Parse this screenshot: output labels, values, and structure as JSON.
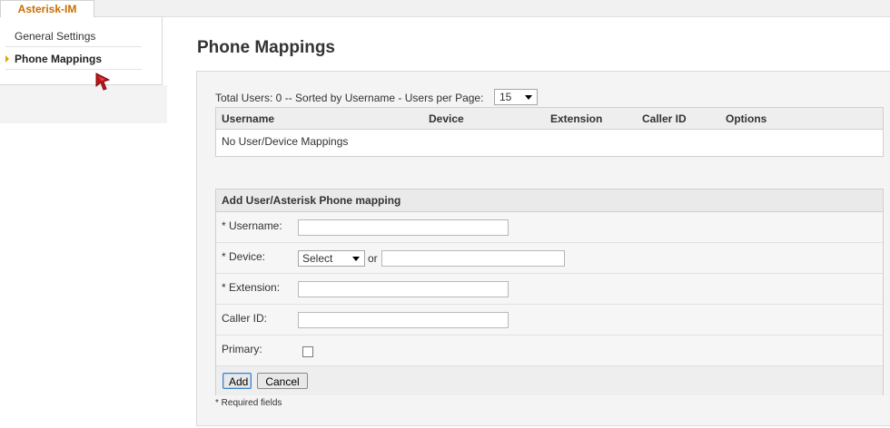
{
  "sidebar": {
    "tab_label": "Asterisk-IM",
    "items": [
      {
        "label": "General Settings"
      },
      {
        "label": "Phone Mappings"
      }
    ]
  },
  "main": {
    "title": "Phone Mappings",
    "summary": "Total Users: 0 -- Sorted by Username - Users per Page:",
    "per_page_value": "15",
    "table": {
      "columns": [
        "Username",
        "Device",
        "Extension",
        "Caller ID",
        "Options"
      ],
      "empty_message": "No User/Device Mappings"
    },
    "form": {
      "title": "Add User/Asterisk Phone mapping",
      "username_label": "* Username:",
      "device_label": "* Device:",
      "device_select_value": "Select",
      "or_text": "or",
      "extension_label": "* Extension:",
      "callerid_label": "Caller ID:",
      "primary_label": "Primary:",
      "add_button": "Add",
      "cancel_button": "Cancel"
    },
    "required_note": "* Required fields"
  },
  "colors": {
    "tab_text": "#c86d00",
    "arrow": "#e8a000",
    "cursor": "#c0141a",
    "focus_button": "#3f80c6"
  },
  "icons": {
    "sidebar_active_marker": "triangle-right-icon",
    "cursor": "mouse-pointer-icon",
    "dropdown": "chevron-down-icon"
  }
}
